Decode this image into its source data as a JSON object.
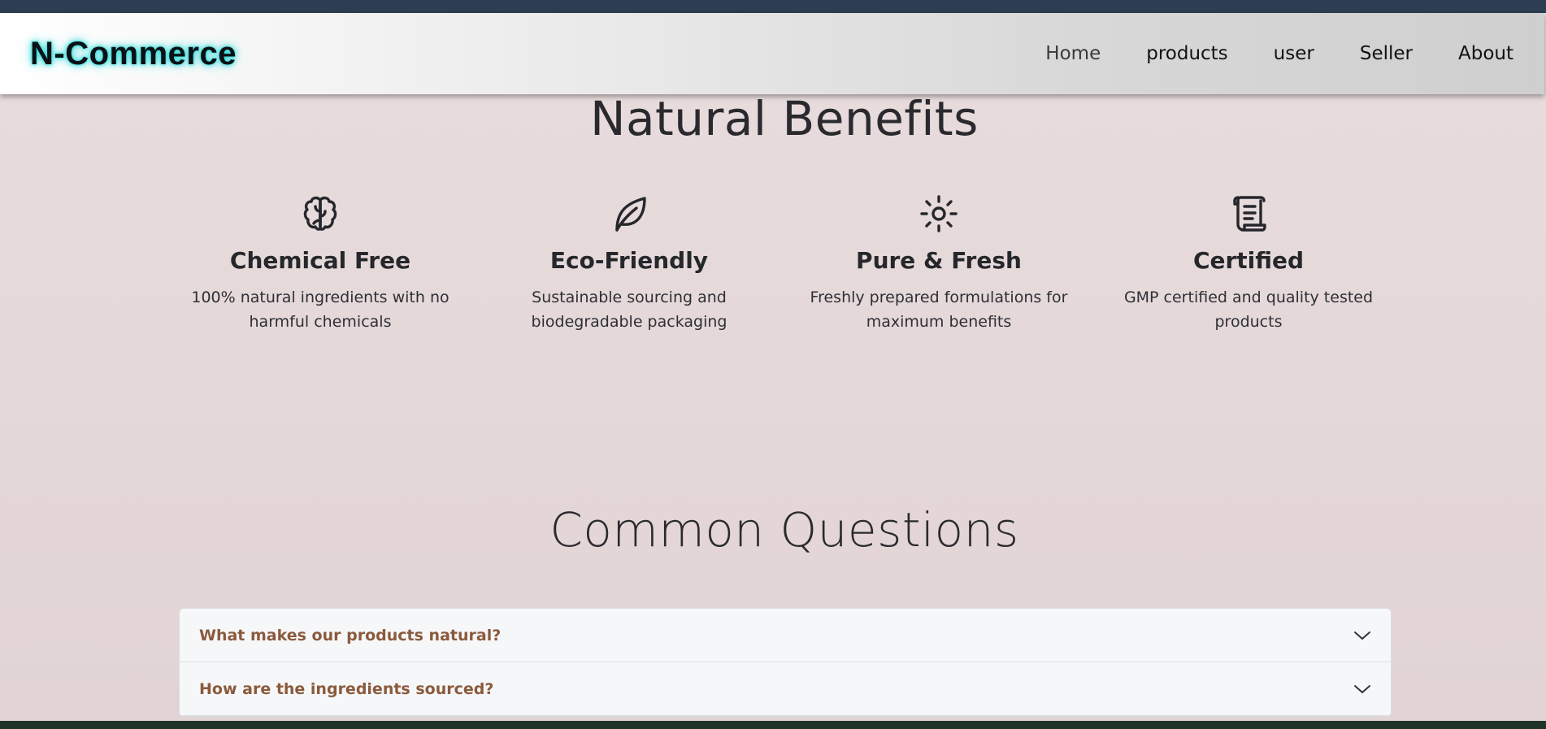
{
  "navbar": {
    "brand": "N-Commerce",
    "links": [
      {
        "label": "Home"
      },
      {
        "label": "products"
      },
      {
        "label": "user"
      },
      {
        "label": "Seller"
      },
      {
        "label": "About"
      }
    ]
  },
  "benefits": {
    "title": "Natural Benefits",
    "items": [
      {
        "icon": "brain-icon",
        "title": "Chemical Free",
        "desc": "100% natural ingredients with no harmful chemicals"
      },
      {
        "icon": "leaf-icon",
        "title": "Eco-Friendly",
        "desc": "Sustainable sourcing and biodegradable packaging"
      },
      {
        "icon": "sun-icon",
        "title": "Pure & Fresh",
        "desc": "Freshly prepared formulations for maximum benefits"
      },
      {
        "icon": "certificate-scroll-icon",
        "title": "Certified",
        "desc": "GMP certified and quality tested products"
      }
    ]
  },
  "faq": {
    "title": "Common Questions",
    "items": [
      {
        "question": "What makes our products natural?"
      },
      {
        "question": "How are the ingredients sourced?"
      }
    ]
  },
  "colors": {
    "accent_text": "#8a5a3c",
    "brand_glow": "#27d8d8",
    "top_strip": "#2e3e52"
  }
}
